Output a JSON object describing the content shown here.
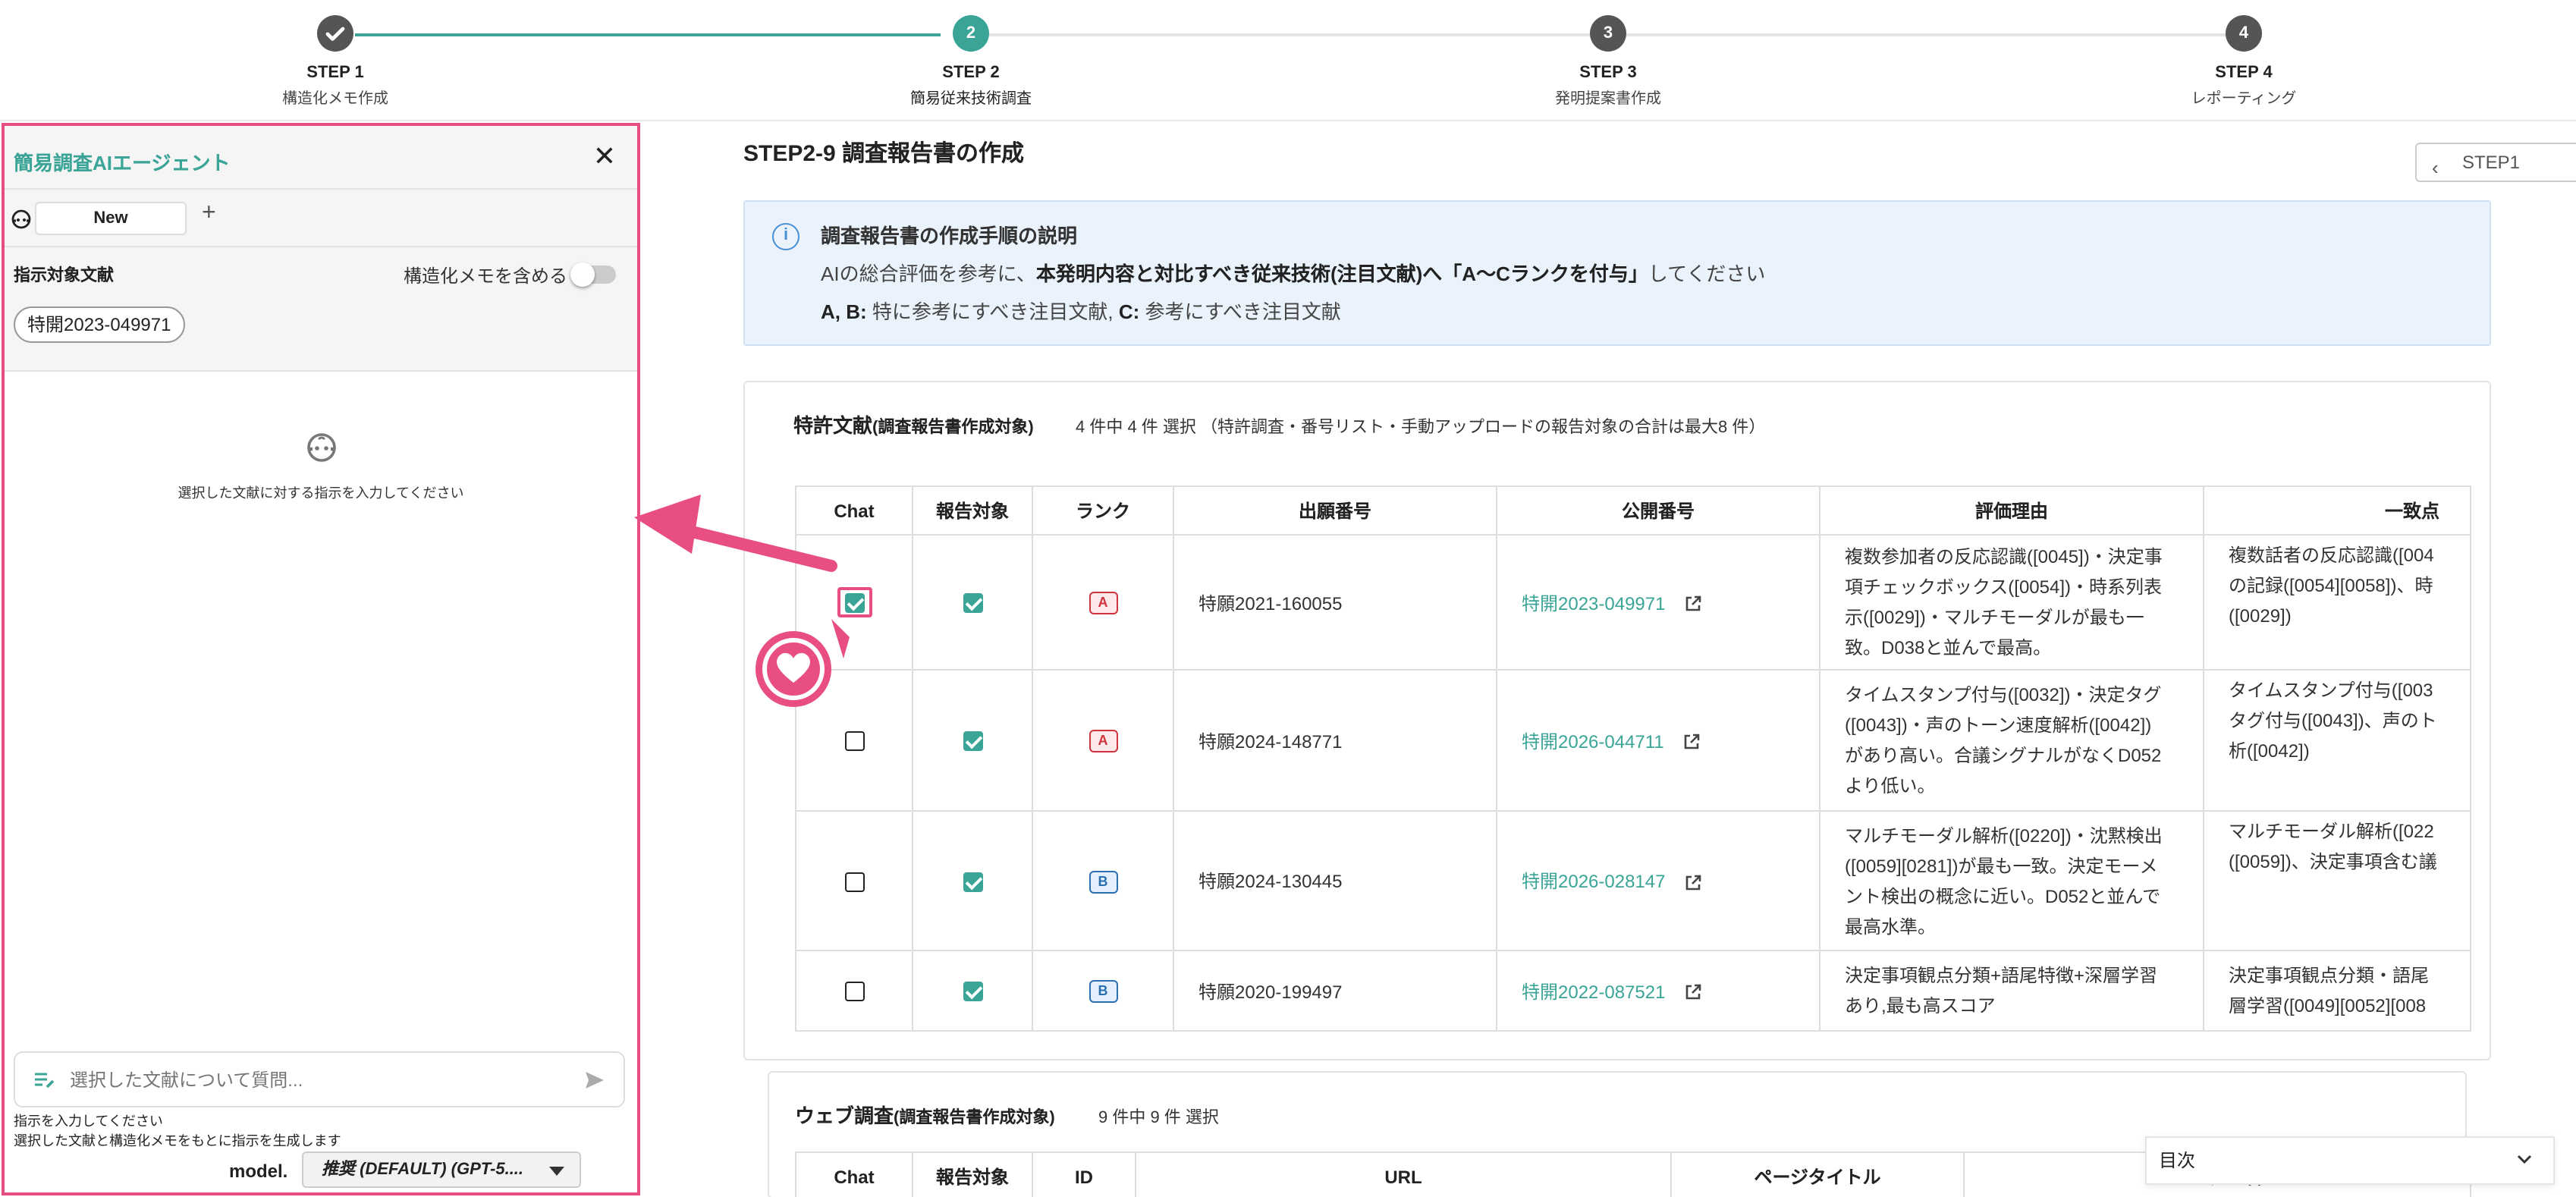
{
  "stepper": {
    "steps": [
      {
        "title": "STEP 1",
        "sub": "構造化メモ作成",
        "state": "done",
        "num": "✓"
      },
      {
        "title": "STEP 2",
        "sub": "簡易従来技術調査",
        "state": "active",
        "num": "2"
      },
      {
        "title": "STEP 3",
        "sub": "発明提案書作成",
        "state": "todo",
        "num": "3"
      },
      {
        "title": "STEP 4",
        "sub": "レポーティング",
        "state": "todo",
        "num": "4"
      }
    ]
  },
  "agent": {
    "title": "簡易調査AIエージェント",
    "tab_new": "New",
    "target_label": "指示対象文献",
    "struct_label": "構造化メモを含める",
    "chip": "特開2023-049971",
    "empty_text": "選択した文献に対する指示を入力してください",
    "input_placeholder": "選択した文献について質問...",
    "help1": "指示を入力してください",
    "help2": "選択した文献と構造化メモをもとに指示を生成します",
    "model_label": "model.",
    "model_value": "推奨 (DEFAULT) (GPT-5...."
  },
  "main": {
    "title": "STEP2-9 調査報告書の作成",
    "back": "STEP1",
    "info": {
      "title": "調査報告書の作成手順の説明",
      "l1_pre": "AIの総合評価を参考に、",
      "l1_bold": "本発明内容と対比すべき従来技術(注目文献)へ「A〜Cランクを付与」",
      "l1_post": "してください",
      "l2_ab": "A, B:",
      "l2_ab_text": " 特に参考にすべき注目文献, ",
      "l2_c": "C:",
      "l2_c_text": " 参考にすべき注目文献"
    },
    "patents": {
      "title": "特許文献",
      "title_small": "(調査報告書作成対象)",
      "count": "4 件中 4 件 選択 （特許調査・番号リスト・手動アップロードの報告対象の合計は最大8 件）",
      "headers": [
        "Chat",
        "報告対象",
        "ランク",
        "出願番号",
        "公開番号",
        "評価理由",
        "一致点"
      ],
      "rows": [
        {
          "chat": true,
          "report": true,
          "rank": "A",
          "app": "特願2021-160055",
          "pub": "特開2023-049971",
          "reason": [
            "複数参加者の反応認識([0045])・決定事",
            "項チェックボックス([0054])・時系列表",
            "示([0029])・マルチモーダルが最も一",
            "致。D038と並んで最高。"
          ],
          "match": [
            "複数話者の反応認識([004",
            "の記録([0054][0058])、時",
            "([0029])"
          ]
        },
        {
          "chat": false,
          "report": true,
          "rank": "A",
          "app": "特願2024-148771",
          "pub": "特開2026-044711",
          "reason": [
            "タイムスタンプ付与([0032])・決定タグ",
            "([0043])・声のトーン速度解析([0042])",
            "があり高い。合議シグナルがなくD052",
            "より低い。"
          ],
          "match": [
            "タイムスタンプ付与([003",
            "タグ付与([0043])、声のト",
            "析([0042])"
          ]
        },
        {
          "chat": false,
          "report": true,
          "rank": "B",
          "app": "特願2024-130445",
          "pub": "特開2026-028147",
          "reason": [
            "マルチモーダル解析([0220])・沈黙検出",
            "([0059][0281])が最も一致。決定モーメ",
            "ント検出の概念に近い。D052と並んで",
            "最高水準。"
          ],
          "match": [
            "マルチモーダル解析([022",
            "([0059])、決定事項含む議"
          ]
        },
        {
          "chat": false,
          "report": true,
          "rank": "B",
          "app": "特願2020-199497",
          "pub": "特開2022-087521",
          "reason": [
            "決定事項観点分類+語尾特徴+深層学習",
            "あり,最も高スコア"
          ],
          "match": [
            "決定事項観点分類・語尾",
            "層学習([0049][0052][008"
          ]
        }
      ]
    },
    "web": {
      "title": "ウェブ調査",
      "title_small": "(調査報告書作成対象)",
      "count": "9 件中 9 件 選択",
      "headers": [
        "Chat",
        "報告対象",
        "ID",
        "URL",
        "ページタイトル",
        "ベンダー名"
      ]
    },
    "toc": "目次"
  },
  "colors": {
    "accent": "#3aa597",
    "highlight": "#e84d84",
    "rankA": "#d0333f",
    "rankB": "#2c6fb0"
  }
}
